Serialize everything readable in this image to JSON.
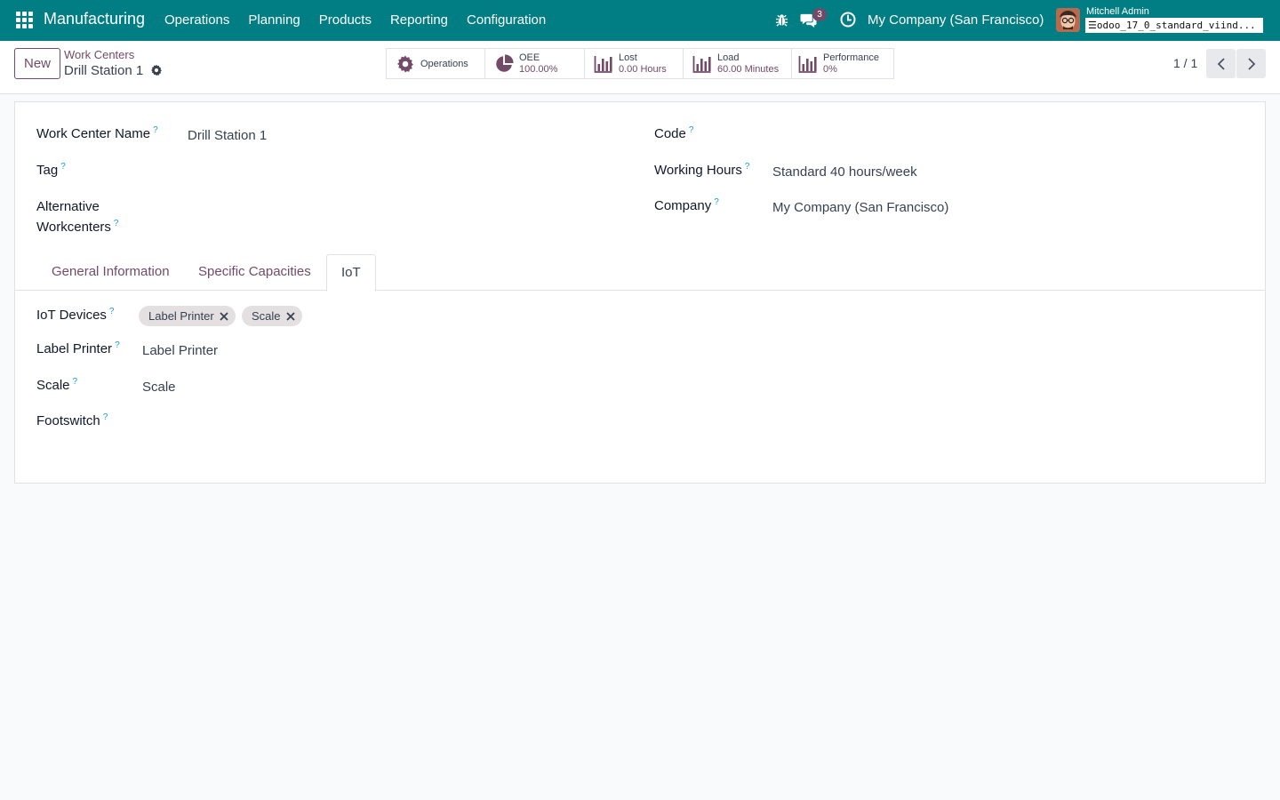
{
  "navbar": {
    "app_title": "Manufacturing",
    "menu": [
      "Operations",
      "Planning",
      "Products",
      "Reporting",
      "Configuration"
    ],
    "chat_count": "3",
    "company": "My Company (San Francisco)",
    "user": "Mitchell Admin",
    "database": "odoo_17_0_standard_viind..."
  },
  "control": {
    "new_label": "New",
    "breadcrumb": "Work Centers",
    "record_title": "Drill Station 1",
    "smart_buttons": {
      "operations": "Operations",
      "oee_label": "OEE",
      "oee_value": "100.00%",
      "lost_label": "Lost",
      "lost_value": "0.00 Hours",
      "load_label": "Load",
      "load_value": "60.00 Minutes",
      "performance_label": "Performance",
      "performance_value": "0%"
    },
    "pager": "1 / 1"
  },
  "form": {
    "work_center_name_label": "Work Center Name",
    "work_center_name": "Drill Station 1",
    "tag_label": "Tag",
    "alternative_label_1": "Alternative",
    "alternative_label_2": "Workcenters",
    "code_label": "Code",
    "working_hours_label": "Working Hours",
    "working_hours": "Standard 40 hours/week",
    "company_label": "Company",
    "company": "My Company (San Francisco)"
  },
  "tabs": [
    "General Information",
    "Specific Capacities",
    "IoT"
  ],
  "iot": {
    "devices_label": "IoT Devices",
    "devices": [
      "Label Printer",
      "Scale"
    ],
    "label_printer_label": "Label Printer",
    "label_printer": "Label Printer",
    "scale_label": "Scale",
    "scale": "Scale",
    "footswitch_label": "Footswitch"
  },
  "help_mark": "?",
  "colors": {
    "navbar": "#017e84",
    "brand": "#714b67",
    "help": "#1a9fd6"
  }
}
